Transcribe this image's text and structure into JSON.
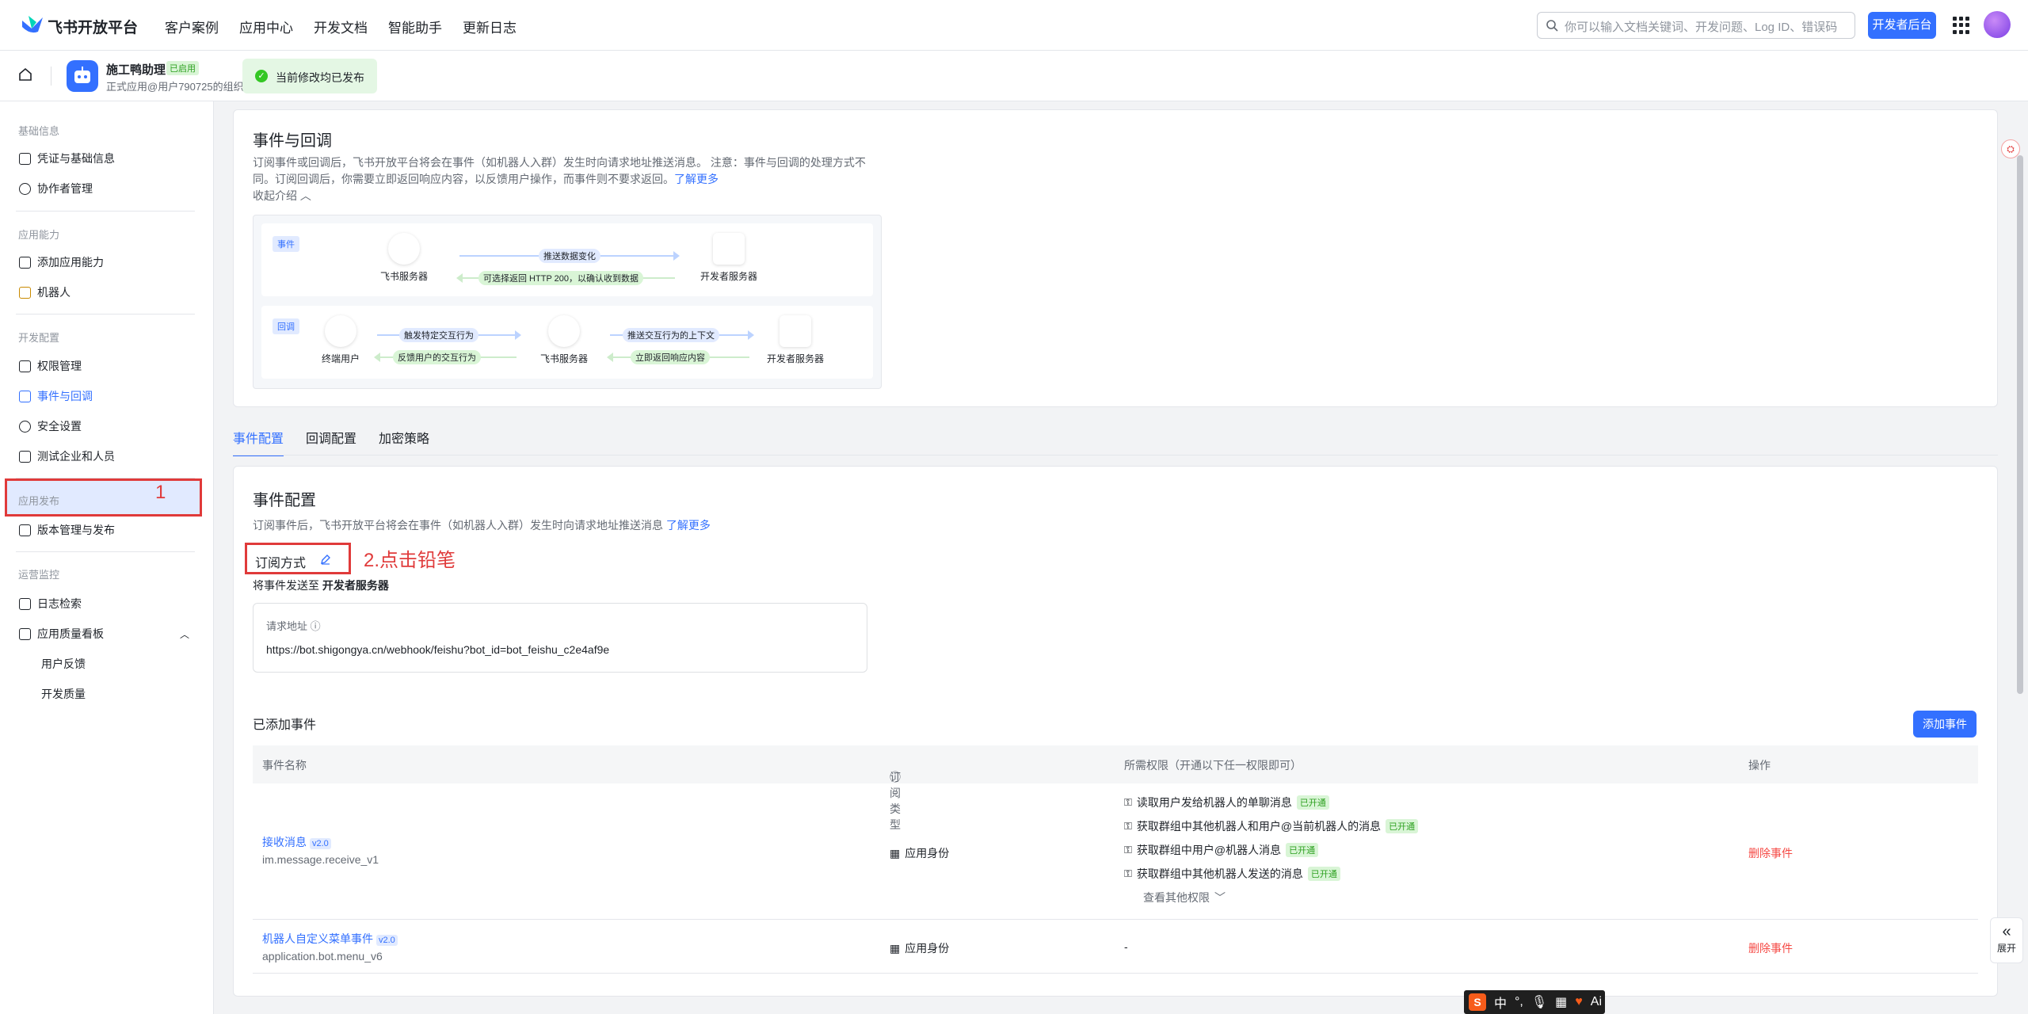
{
  "topnav": {
    "brand": "飞书开放平台",
    "links": [
      "客户案例",
      "应用中心",
      "开发文档",
      "智能助手",
      "更新日志"
    ],
    "search_placeholder": "你可以输入文档关键词、开发问题、Log ID、错误码",
    "dev_console": "开发者后台"
  },
  "appbar": {
    "app_name": "施工鸭助理",
    "status": "已启用",
    "subtitle": "正式应用@用户790725的组织",
    "publish_status": "当前修改均已发布"
  },
  "sidebar": {
    "sections": [
      {
        "title": "基础信息",
        "items": [
          "凭证与基础信息",
          "协作者管理"
        ]
      },
      {
        "title": "应用能力",
        "items": [
          "添加应用能力",
          "机器人"
        ]
      },
      {
        "title": "开发配置",
        "items": [
          "权限管理",
          "事件与回调",
          "安全设置",
          "测试企业和人员"
        ]
      },
      {
        "title": "应用发布",
        "items": [
          "版本管理与发布"
        ]
      },
      {
        "title": "运营监控",
        "items": [
          "日志检索",
          "应用质量看板",
          "用户反馈",
          "开发质量"
        ]
      }
    ],
    "annotation": "1"
  },
  "intro": {
    "title": "事件与回调",
    "desc1": "订阅事件或回调后，飞书开放平台将会在事件（如机器人入群）发生时向请求地址推送消息。 注意：事件与回调的处理方式不",
    "desc2": "同。订阅回调后，你需要立即返回响应内容，以反馈用户操作，而事件则不要求返回。",
    "learn_more": "了解更多",
    "collapse": "收起介绍",
    "event_tag": "事件",
    "callback_tag": "回调",
    "feishu_server": "飞书服务器",
    "dev_server": "开发者服务器",
    "end_user": "终端用户",
    "push_change": "推送数据变化",
    "optional_return": "可选择返回 HTTP 200，以确认收到数据",
    "trigger": "触发特定交互行为",
    "feedback": "反馈用户的交互行为",
    "push_context": "推送交互行为的上下文",
    "return_resp": "立即返回响应内容"
  },
  "tabs": [
    "事件配置",
    "回调配置",
    "加密策略"
  ],
  "config": {
    "title": "事件配置",
    "desc": "订阅事件后，飞书开放平台将会在事件（如机器人入群）发生时向请求地址推送消息",
    "learn_more": "了解更多",
    "mode_label": "订阅方式",
    "annotation": "2.点击铅笔",
    "send_to_prefix": "将事件发送至",
    "send_to_target": "开发者服务器",
    "url_label": "请求地址",
    "url": "https://bot.shigongya.cn/webhook/feishu?bot_id=bot_feishu_c2e4af9e",
    "added_title": "已添加事件",
    "add_button": "添加事件",
    "columns": [
      "事件名称",
      "订阅类型",
      "所需权限（开通以下任一权限即可）",
      "操作"
    ],
    "events": [
      {
        "name": "接收消息",
        "version": "v2.0",
        "key": "im.message.receive_v1",
        "type": "应用身份",
        "perms": [
          "读取用户发给机器人的单聊消息",
          "获取群组中其他机器人和用户@当前机器人的消息",
          "获取群组中用户@机器人消息",
          "获取群组中其他机器人发送的消息"
        ],
        "perm_tag": "已开通",
        "more": "查看其他权限",
        "action": "删除事件"
      },
      {
        "name": "机器人自定义菜单事件",
        "version": "v2.0",
        "key": "application.bot.menu_v6",
        "type": "应用身份",
        "perm_none": "-",
        "action": "删除事件"
      }
    ]
  },
  "widgets": {
    "expand": "展开",
    "ime_lang": "中",
    "ime_ai": "Ai"
  }
}
